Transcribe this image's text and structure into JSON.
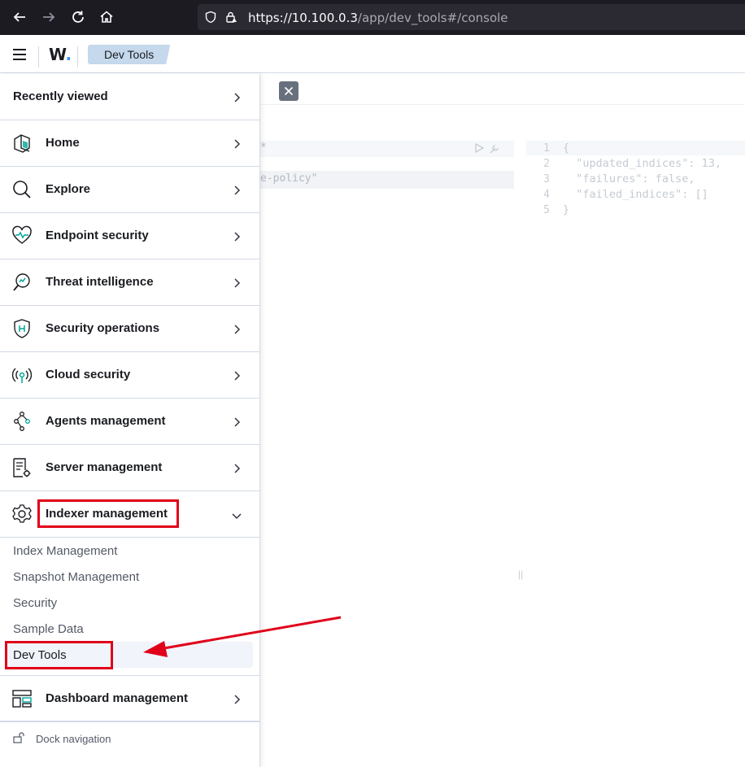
{
  "browser": {
    "url_host": "https://10.100.0.3",
    "url_path": "/app/dev_tools#/console"
  },
  "header": {
    "logo": "W",
    "logo_dot": ".",
    "breadcrumb": "Dev Tools"
  },
  "console": {
    "request_star": "*",
    "request_text": "e-policy\"",
    "response_lines": [
      "1",
      "2",
      "3",
      "4",
      "5"
    ],
    "response_code": "{\n  \"updated_indices\": 13,\n  \"failures\": false,\n  \"failed_indices\": []\n}",
    "resizer": "||"
  },
  "sidenav": {
    "recently_viewed": "Recently viewed",
    "items": [
      {
        "label": "Home",
        "icon": "home-icon"
      },
      {
        "label": "Explore",
        "icon": "search-icon"
      },
      {
        "label": "Endpoint security",
        "icon": "heart-pulse-icon"
      },
      {
        "label": "Threat intelligence",
        "icon": "threat-search-icon"
      },
      {
        "label": "Security operations",
        "icon": "shield-icon"
      },
      {
        "label": "Cloud security",
        "icon": "antenna-icon"
      },
      {
        "label": "Agents management",
        "icon": "nodes-icon"
      },
      {
        "label": "Server management",
        "icon": "document-gear-icon"
      },
      {
        "label": "Indexer management",
        "icon": "gear-icon"
      }
    ],
    "sub_items": [
      "Index Management",
      "Snapshot Management",
      "Security",
      "Sample Data",
      "Dev Tools"
    ],
    "dashboard": {
      "label": "Dashboard management",
      "icon": "dashboard-icon"
    },
    "dock": "Dock navigation"
  },
  "colors": {
    "accent": "#3595f9",
    "icon_teal": "#00a69b",
    "annotation_red": "#e0001a"
  }
}
